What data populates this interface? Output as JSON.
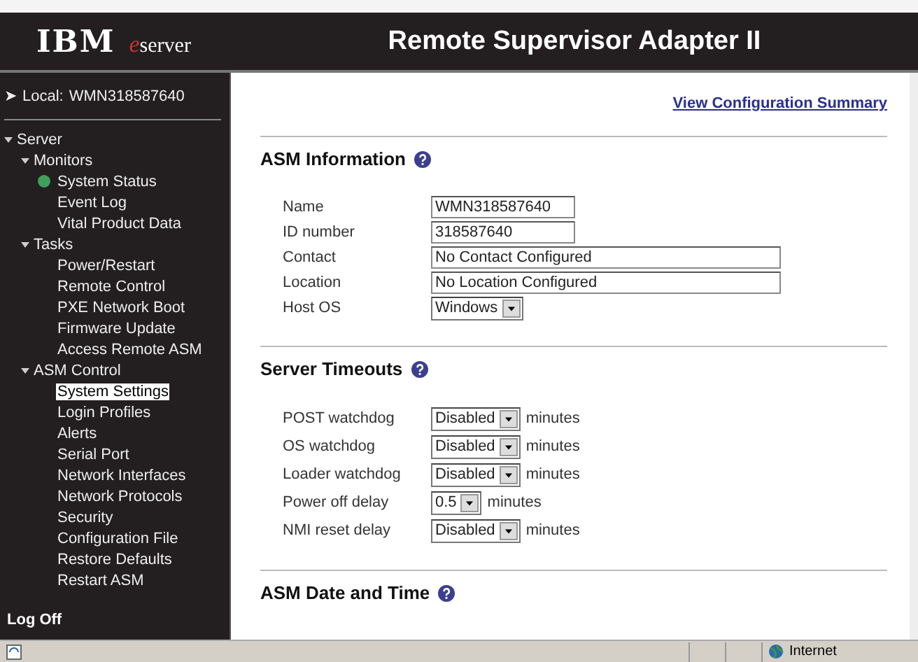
{
  "header": {
    "logo": "IBM",
    "logo_sub_mark": "e",
    "logo_sub": "server",
    "title": "Remote Supervisor Adapter II"
  },
  "sidebar": {
    "local": {
      "arrow": "➤",
      "label": "Local:",
      "value": "WMN318587640"
    },
    "tree": [
      {
        "label": "Server",
        "expanded": true,
        "children": [
          {
            "label": "Monitors",
            "expanded": true,
            "children": [
              {
                "label": "System Status",
                "color": "#3fa05a",
                "selected": false
              },
              {
                "label": "Event Log",
                "selected": false
              },
              {
                "label": "Vital Product Data",
                "selected": false
              }
            ]
          },
          {
            "label": "Tasks",
            "expanded": true,
            "children": [
              {
                "label": "Power/Restart",
                "selected": false
              },
              {
                "label": "Remote Control",
                "selected": false
              },
              {
                "label": "PXE Network Boot",
                "selected": false
              },
              {
                "label": "Firmware Update",
                "selected": false
              },
              {
                "label": "Access Remote ASM",
                "selected": false
              }
            ]
          },
          {
            "label": "ASM Control",
            "expanded": true,
            "children": [
              {
                "label": "System Settings",
                "selected": true
              },
              {
                "label": "Login Profiles",
                "selected": false
              },
              {
                "label": "Alerts",
                "selected": false
              },
              {
                "label": "Serial Port",
                "selected": false
              },
              {
                "label": "Network Interfaces",
                "selected": false
              },
              {
                "label": "Network Protocols",
                "selected": false
              },
              {
                "label": "Security",
                "selected": false
              },
              {
                "label": "Configuration File",
                "selected": false
              },
              {
                "label": "Restore Defaults",
                "selected": false
              },
              {
                "label": "Restart ASM",
                "selected": false
              }
            ]
          }
        ]
      }
    ],
    "log_off": "Log Off"
  },
  "main": {
    "summary_link": "View Configuration Summary",
    "sections": [
      {
        "title": "ASM Information",
        "rows": [
          {
            "kind": "text",
            "label": "Name",
            "value": "WMN318587640"
          },
          {
            "kind": "text",
            "label": "ID number",
            "value": "318587640"
          },
          {
            "kind": "widetext",
            "label": "Contact",
            "value": "No Contact Configured"
          },
          {
            "kind": "widetext",
            "label": "Location",
            "value": "No Location Configured"
          },
          {
            "kind": "select",
            "label": "Host OS",
            "value": "Windows"
          }
        ]
      },
      {
        "title": "Server Timeouts",
        "rows": [
          {
            "kind": "select",
            "label": "POST watchdog",
            "value": "Disabled",
            "unit": "minutes"
          },
          {
            "kind": "select",
            "label": "OS watchdog",
            "value": "Disabled",
            "unit": "minutes"
          },
          {
            "kind": "select",
            "label": "Loader watchdog",
            "value": "Disabled",
            "unit": "minutes"
          },
          {
            "kind": "select",
            "label": "Power off delay",
            "value": "0.5",
            "unit": "minutes"
          },
          {
            "kind": "select",
            "label": "NMI reset delay",
            "value": "Disabled",
            "unit": "minutes"
          }
        ]
      },
      {
        "title": "ASM Date and Time"
      }
    ]
  },
  "status_bar": {
    "zone": "Internet"
  }
}
